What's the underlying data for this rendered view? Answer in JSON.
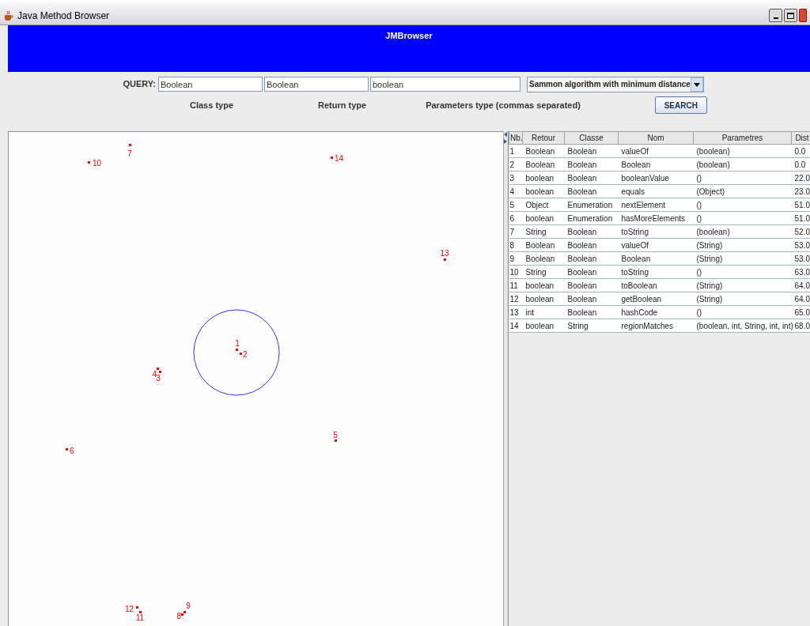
{
  "window": {
    "title": "Java Method Browser"
  },
  "banner": {
    "title": "JMBrowser"
  },
  "query": {
    "label": "QUERY:",
    "fields": [
      {
        "value": "Boolean",
        "caption": "Class type"
      },
      {
        "value": "Boolean",
        "caption": "Return type"
      },
      {
        "value": "boolean",
        "caption": "Parameters type (commas separated)"
      }
    ],
    "algorithm": "Sammon algorithm with minimum distance",
    "search_button": "SEARCH"
  },
  "plot": {
    "points": [
      "1",
      "2",
      "3",
      "4",
      "5",
      "6",
      "7",
      "8",
      "9",
      "10",
      "11",
      "12",
      "13",
      "14"
    ]
  },
  "table": {
    "columns": [
      "Nb.",
      "Retour",
      "Classe",
      "Nom",
      "Parametres",
      "Dist"
    ],
    "rows": [
      [
        "1",
        "Boolean",
        "Boolean",
        "valueOf",
        "(boolean)",
        "0.0"
      ],
      [
        "2",
        "Boolean",
        "Boolean",
        "Boolean",
        "(boolean)",
        "0.0"
      ],
      [
        "3",
        "boolean",
        "Boolean",
        "booleanValue",
        "()",
        "22.0"
      ],
      [
        "4",
        "boolean",
        "Boolean",
        "equals",
        "(Object)",
        "23.0"
      ],
      [
        "5",
        "Object",
        "Enumeration",
        "nextElement",
        "()",
        "51.0"
      ],
      [
        "6",
        "boolean",
        "Enumeration",
        "hasMoreElements",
        "()",
        "51.0"
      ],
      [
        "7",
        "String",
        "Boolean",
        "toString",
        "(boolean)",
        "52.0"
      ],
      [
        "8",
        "Boolean",
        "Boolean",
        "valueOf",
        "(String)",
        "53.0"
      ],
      [
        "9",
        "Boolean",
        "Boolean",
        "Boolean",
        "(String)",
        "53.0"
      ],
      [
        "10",
        "String",
        "Boolean",
        "toString",
        "()",
        "63.0"
      ],
      [
        "11",
        "boolean",
        "Boolean",
        "toBoolean",
        "(String)",
        "64.0"
      ],
      [
        "12",
        "boolean",
        "Boolean",
        "getBoolean",
        "(String)",
        "64.0"
      ],
      [
        "13",
        "int",
        "Boolean",
        "hashCode",
        "()",
        "65.0"
      ],
      [
        "14",
        "boolean",
        "String",
        "regionMatches",
        "(boolean, int, String, int, int)",
        "68.0"
      ]
    ]
  }
}
